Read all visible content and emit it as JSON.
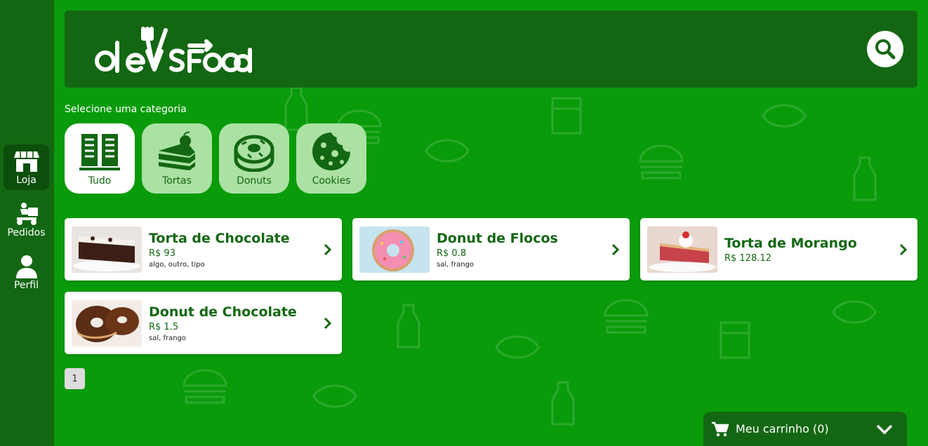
{
  "app": {
    "logo_text": "devsFood"
  },
  "sidebar": {
    "items": [
      {
        "label": "Loja",
        "icon": "store-icon",
        "active": true
      },
      {
        "label": "Pedidos",
        "icon": "delivery-icon",
        "active": false
      },
      {
        "label": "Perfil",
        "icon": "user-icon",
        "active": false
      }
    ]
  },
  "header": {
    "search_icon": "search-icon"
  },
  "categories": {
    "title": "Selecione uma categoria",
    "items": [
      {
        "label": "Tudo",
        "icon": "menu-book-icon",
        "active": true
      },
      {
        "label": "Tortas",
        "icon": "cake-icon",
        "active": false
      },
      {
        "label": "Donuts",
        "icon": "donut-icon",
        "active": false
      },
      {
        "label": "Cookies",
        "icon": "cookie-icon",
        "active": false
      }
    ]
  },
  "products": [
    {
      "name": "Torta de Chocolate",
      "price": "R$ 93",
      "ingredients": "algo, outro, tipo"
    },
    {
      "name": "Donut de Flocos",
      "price": "R$ 0.8",
      "ingredients": "sal, frango"
    },
    {
      "name": "Torta de Morango",
      "price": "R$ 128.12",
      "ingredients": ""
    },
    {
      "name": "Donut de Chocolate",
      "price": "R$ 1.5",
      "ingredients": "sal, frango"
    }
  ],
  "pagination": {
    "pages": [
      "1"
    ]
  },
  "cart": {
    "label": "Meu carrinho (0)"
  },
  "colors": {
    "background": "#0a9b0a",
    "dark_green": "#136712",
    "light_green": "#abe1a3"
  }
}
